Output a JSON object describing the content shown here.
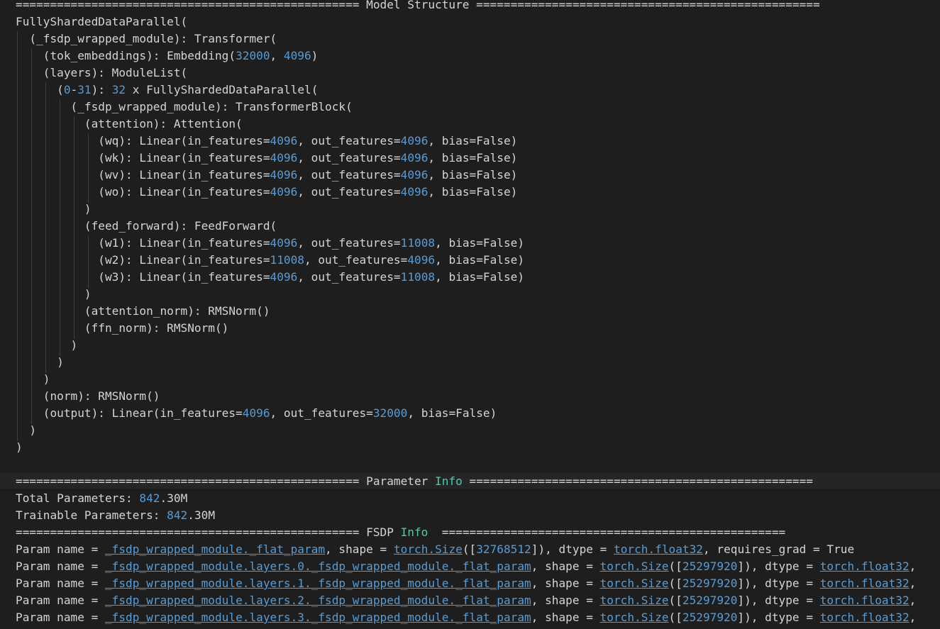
{
  "colors": {
    "background": "#1e1e1e",
    "text": "#d4d4d4",
    "number": "#569cd6",
    "keyword": "#4ec9b0",
    "link": "#569cd6",
    "indent_guide": "#404040",
    "separator_band": "#252525"
  },
  "lines": [
    {
      "segments": [
        {
          "t": "================================================== Model Structure ==================================================",
          "s": "text"
        }
      ]
    },
    {
      "segments": [
        {
          "t": "FullyShardedDataParallel(",
          "s": "text"
        }
      ]
    },
    {
      "segments": [
        {
          "t": "  (_fsdp_wrapped_module): Transformer(",
          "s": "text"
        }
      ]
    },
    {
      "segments": [
        {
          "t": "    (tok_embeddings): Embedding(",
          "s": "text"
        },
        {
          "t": "32000",
          "s": "num"
        },
        {
          "t": ", ",
          "s": "text"
        },
        {
          "t": "4096",
          "s": "num"
        },
        {
          "t": ")",
          "s": "text"
        }
      ]
    },
    {
      "segments": [
        {
          "t": "    (layers): ModuleList(",
          "s": "text"
        }
      ]
    },
    {
      "segments": [
        {
          "t": "      (",
          "s": "text"
        },
        {
          "t": "0",
          "s": "num"
        },
        {
          "t": "-",
          "s": "text"
        },
        {
          "t": "31",
          "s": "num"
        },
        {
          "t": "): ",
          "s": "text"
        },
        {
          "t": "32",
          "s": "num"
        },
        {
          "t": " x FullyShardedDataParallel(",
          "s": "text"
        }
      ]
    },
    {
      "segments": [
        {
          "t": "        (_fsdp_wrapped_module): TransformerBlock(",
          "s": "text"
        }
      ]
    },
    {
      "segments": [
        {
          "t": "          (attention): Attention(",
          "s": "text"
        }
      ]
    },
    {
      "segments": [
        {
          "t": "            (wq): Linear(in_features=",
          "s": "text"
        },
        {
          "t": "4096",
          "s": "num"
        },
        {
          "t": ", out_features=",
          "s": "text"
        },
        {
          "t": "4096",
          "s": "num"
        },
        {
          "t": ", bias=False)",
          "s": "text"
        }
      ]
    },
    {
      "segments": [
        {
          "t": "            (wk): Linear(in_features=",
          "s": "text"
        },
        {
          "t": "4096",
          "s": "num"
        },
        {
          "t": ", out_features=",
          "s": "text"
        },
        {
          "t": "4096",
          "s": "num"
        },
        {
          "t": ", bias=False)",
          "s": "text"
        }
      ]
    },
    {
      "segments": [
        {
          "t": "            (wv): Linear(in_features=",
          "s": "text"
        },
        {
          "t": "4096",
          "s": "num"
        },
        {
          "t": ", out_features=",
          "s": "text"
        },
        {
          "t": "4096",
          "s": "num"
        },
        {
          "t": ", bias=False)",
          "s": "text"
        }
      ]
    },
    {
      "segments": [
        {
          "t": "            (wo): Linear(in_features=",
          "s": "text"
        },
        {
          "t": "4096",
          "s": "num"
        },
        {
          "t": ", out_features=",
          "s": "text"
        },
        {
          "t": "4096",
          "s": "num"
        },
        {
          "t": ", bias=False)",
          "s": "text"
        }
      ]
    },
    {
      "segments": [
        {
          "t": "          )",
          "s": "text"
        }
      ]
    },
    {
      "segments": [
        {
          "t": "          (feed_forward): FeedForward(",
          "s": "text"
        }
      ]
    },
    {
      "segments": [
        {
          "t": "            (w1): Linear(in_features=",
          "s": "text"
        },
        {
          "t": "4096",
          "s": "num"
        },
        {
          "t": ", out_features=",
          "s": "text"
        },
        {
          "t": "11008",
          "s": "num"
        },
        {
          "t": ", bias=False)",
          "s": "text"
        }
      ]
    },
    {
      "segments": [
        {
          "t": "            (w2): Linear(in_features=",
          "s": "text"
        },
        {
          "t": "11008",
          "s": "num"
        },
        {
          "t": ", out_features=",
          "s": "text"
        },
        {
          "t": "4096",
          "s": "num"
        },
        {
          "t": ", bias=False)",
          "s": "text"
        }
      ]
    },
    {
      "segments": [
        {
          "t": "            (w3): Linear(in_features=",
          "s": "text"
        },
        {
          "t": "4096",
          "s": "num"
        },
        {
          "t": ", out_features=",
          "s": "text"
        },
        {
          "t": "11008",
          "s": "num"
        },
        {
          "t": ", bias=False)",
          "s": "text"
        }
      ]
    },
    {
      "segments": [
        {
          "t": "          )",
          "s": "text"
        }
      ]
    },
    {
      "segments": [
        {
          "t": "          (attention_norm): RMSNorm()",
          "s": "text"
        }
      ]
    },
    {
      "segments": [
        {
          "t": "          (ffn_norm): RMSNorm()",
          "s": "text"
        }
      ]
    },
    {
      "segments": [
        {
          "t": "        )",
          "s": "text"
        }
      ]
    },
    {
      "segments": [
        {
          "t": "      )",
          "s": "text"
        }
      ]
    },
    {
      "segments": [
        {
          "t": "    )",
          "s": "text"
        }
      ]
    },
    {
      "segments": [
        {
          "t": "    (norm): RMSNorm()",
          "s": "text"
        }
      ]
    },
    {
      "segments": [
        {
          "t": "    (output): Linear(in_features=",
          "s": "text"
        },
        {
          "t": "4096",
          "s": "num"
        },
        {
          "t": ", out_features=",
          "s": "text"
        },
        {
          "t": "32000",
          "s": "num"
        },
        {
          "t": ", bias=False)",
          "s": "text"
        }
      ]
    },
    {
      "segments": [
        {
          "t": "  )",
          "s": "text"
        }
      ]
    },
    {
      "segments": [
        {
          "t": ")",
          "s": "text"
        }
      ]
    },
    {
      "segments": []
    },
    {
      "segments": [
        {
          "t": "================================================== Parameter ",
          "s": "text"
        },
        {
          "t": "Info",
          "s": "green"
        },
        {
          "t": " ==================================================",
          "s": "text"
        }
      ]
    },
    {
      "segments": [
        {
          "t": "Total Parameters: ",
          "s": "text"
        },
        {
          "t": "842",
          "s": "num"
        },
        {
          "t": ".30M",
          "s": "text"
        }
      ]
    },
    {
      "segments": [
        {
          "t": "Trainable Parameters: ",
          "s": "text"
        },
        {
          "t": "842",
          "s": "num"
        },
        {
          "t": ".30M",
          "s": "text"
        }
      ]
    },
    {
      "segments": [
        {
          "t": "================================================== FSDP ",
          "s": "text"
        },
        {
          "t": "Info",
          "s": "green"
        },
        {
          "t": "  ==================================================",
          "s": "text"
        }
      ]
    },
    {
      "segments": [
        {
          "t": "Param name = ",
          "s": "text"
        },
        {
          "t": "_fsdp_wrapped_module._flat_param",
          "s": "link"
        },
        {
          "t": ", shape = ",
          "s": "text"
        },
        {
          "t": "torch.Size",
          "s": "link"
        },
        {
          "t": "([",
          "s": "text"
        },
        {
          "t": "32768512",
          "s": "num"
        },
        {
          "t": "]), dtype = ",
          "s": "text"
        },
        {
          "t": "torch.float32",
          "s": "link"
        },
        {
          "t": ", requires_grad = True",
          "s": "text"
        }
      ]
    },
    {
      "segments": [
        {
          "t": "Param name = ",
          "s": "text"
        },
        {
          "t": "_fsdp_wrapped_module.layers.0._fsdp_wrapped_module._flat_param",
          "s": "link"
        },
        {
          "t": ", shape = ",
          "s": "text"
        },
        {
          "t": "torch.Size",
          "s": "link"
        },
        {
          "t": "([",
          "s": "text"
        },
        {
          "t": "25297920",
          "s": "num"
        },
        {
          "t": "]), dtype = ",
          "s": "text"
        },
        {
          "t": "torch.float32",
          "s": "link"
        },
        {
          "t": ",",
          "s": "text"
        }
      ]
    },
    {
      "segments": [
        {
          "t": "Param name = ",
          "s": "text"
        },
        {
          "t": "_fsdp_wrapped_module.layers.1._fsdp_wrapped_module._flat_param",
          "s": "link"
        },
        {
          "t": ", shape = ",
          "s": "text"
        },
        {
          "t": "torch.Size",
          "s": "link"
        },
        {
          "t": "([",
          "s": "text"
        },
        {
          "t": "25297920",
          "s": "num"
        },
        {
          "t": "]), dtype = ",
          "s": "text"
        },
        {
          "t": "torch.float32",
          "s": "link"
        },
        {
          "t": ",",
          "s": "text"
        }
      ]
    },
    {
      "segments": [
        {
          "t": "Param name = ",
          "s": "text"
        },
        {
          "t": "_fsdp_wrapped_module.layers.2._fsdp_wrapped_module._flat_param",
          "s": "link"
        },
        {
          "t": ", shape = ",
          "s": "text"
        },
        {
          "t": "torch.Size",
          "s": "link"
        },
        {
          "t": "([",
          "s": "text"
        },
        {
          "t": "25297920",
          "s": "num"
        },
        {
          "t": "]), dtype = ",
          "s": "text"
        },
        {
          "t": "torch.float32",
          "s": "link"
        },
        {
          "t": ",",
          "s": "text"
        }
      ]
    },
    {
      "segments": [
        {
          "t": "Param name = ",
          "s": "text"
        },
        {
          "t": "_fsdp_wrapped_module.layers.3._fsdp_wrapped_module._flat_param",
          "s": "link"
        },
        {
          "t": ", shape = ",
          "s": "text"
        },
        {
          "t": "torch.Size",
          "s": "link"
        },
        {
          "t": "([",
          "s": "text"
        },
        {
          "t": "25297920",
          "s": "num"
        },
        {
          "t": "]), dtype = ",
          "s": "text"
        },
        {
          "t": "torch.float32",
          "s": "link"
        },
        {
          "t": ",",
          "s": "text"
        }
      ]
    }
  ]
}
